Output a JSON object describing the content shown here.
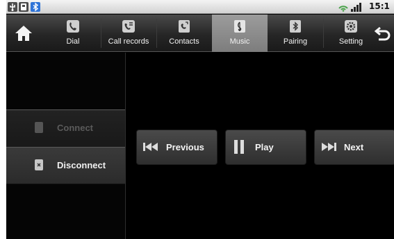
{
  "status_bar": {
    "time": "15:1",
    "icons": [
      "usb-debug-icon",
      "sd-card-icon",
      "bluetooth-icon",
      "wifi-icon",
      "signal-icon"
    ]
  },
  "nav": {
    "home_icon": "home-icon",
    "back_icon": "back-arrow-icon",
    "tabs": [
      {
        "label": "Dial",
        "icon": "phone-icon"
      },
      {
        "label": "Call records",
        "icon": "call-log-icon"
      },
      {
        "label": "Contacts",
        "icon": "contacts-icon"
      },
      {
        "label": "Music",
        "icon": "music-icon",
        "active": true
      },
      {
        "label": "Pairing",
        "icon": "bluetooth-pairing-icon"
      },
      {
        "label": "Setting",
        "icon": "gear-icon"
      }
    ]
  },
  "connection": {
    "connect_label": "Connect",
    "connect_enabled": false,
    "disconnect_label": "Disconnect"
  },
  "media": {
    "previous_label": "Previous",
    "play_label": "Play",
    "next_label": "Next"
  },
  "colors": {
    "active_tab": "#8a8a8a",
    "bluetooth": "#2f74d8",
    "background": "#000000"
  }
}
